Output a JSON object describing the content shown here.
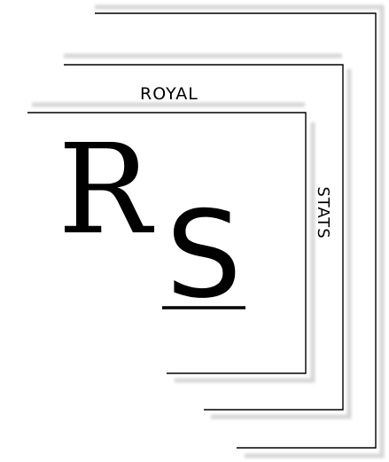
{
  "logo": {
    "top_word": "ROYAL",
    "side_word": "STATS",
    "monogram_first": "R",
    "monogram_second": "S",
    "ink_color": "#000000",
    "shadow_color": "#d6d6d6"
  }
}
